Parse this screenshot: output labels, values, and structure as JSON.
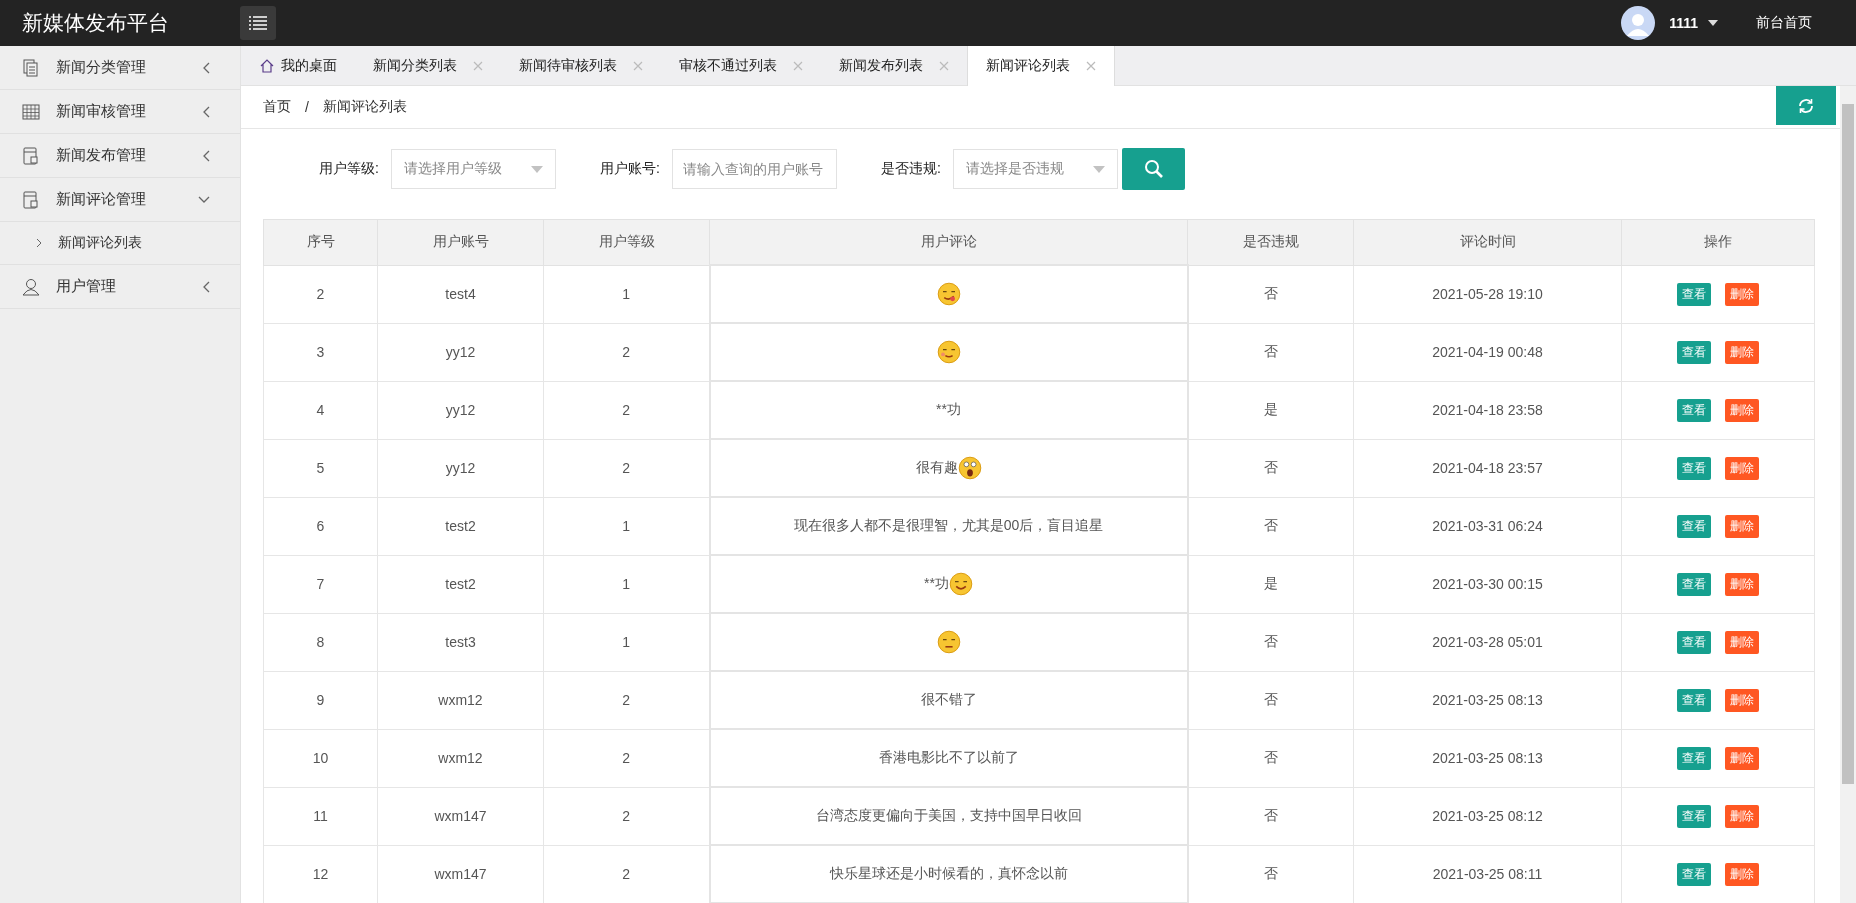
{
  "header": {
    "logo": "新媒体发布平台",
    "user": "1111",
    "home_link": "前台首页"
  },
  "sidebar": {
    "items": [
      {
        "label": "新闻分类管理",
        "expanded": false
      },
      {
        "label": "新闻审核管理",
        "expanded": false
      },
      {
        "label": "新闻发布管理",
        "expanded": false
      },
      {
        "label": "新闻评论管理",
        "expanded": true,
        "children": [
          {
            "label": "新闻评论列表"
          }
        ]
      },
      {
        "label": "用户管理",
        "expanded": false
      }
    ]
  },
  "tabs": [
    {
      "label": "我的桌面",
      "kind": "home",
      "selected": false
    },
    {
      "label": "新闻分类列表",
      "kind": "page",
      "selected": false
    },
    {
      "label": "新闻待审核列表",
      "kind": "page",
      "selected": false
    },
    {
      "label": "审核不通过列表",
      "kind": "page",
      "selected": false
    },
    {
      "label": "新闻发布列表",
      "kind": "page",
      "selected": false
    },
    {
      "label": "新闻评论列表",
      "kind": "page",
      "selected": true
    }
  ],
  "breadcrumb": [
    "首页",
    "/",
    "新闻评论列表"
  ],
  "filters": [
    {
      "label": "用户等级:",
      "kind": "select",
      "placeholder": "请选择用户等级"
    },
    {
      "label": "用户账号:",
      "kind": "input",
      "placeholder": "请输入查询的用户账号"
    },
    {
      "label": "是否违规:",
      "kind": "select",
      "placeholder": "请选择是否违规"
    }
  ],
  "table": {
    "columns": [
      "序号",
      "用户账号",
      "用户等级",
      "用户评论",
      "是否违规",
      "评论时间",
      "操作"
    ],
    "rows": [
      {
        "no": "2",
        "account": "test4",
        "level": "1",
        "kind": "emoji",
        "violation": "否",
        "time": "2021-05-28 19:10",
        "actions": [
          "查看",
          "删除"
        ]
      },
      {
        "no": "3",
        "account": "yy12",
        "level": "2",
        "kind": "emoji",
        "violation": "否",
        "time": "2021-04-19 00:48",
        "actions": [
          "查看",
          "删除"
        ]
      },
      {
        "no": "4",
        "account": "yy12",
        "level": "2",
        "comment": "**功",
        "violation": "是",
        "time": "2021-04-18 23:58",
        "actions": [
          "查看",
          "删除"
        ]
      },
      {
        "no": "5",
        "account": "yy12",
        "level": "2",
        "comment": "很有趣",
        "kind": "text-emoji",
        "violation": "否",
        "time": "2021-04-18 23:57",
        "actions": [
          "查看",
          "删除"
        ]
      },
      {
        "no": "6",
        "account": "test2",
        "level": "1",
        "comment": "现在很多人都不是很理智，尤其是00后，盲目追星",
        "violation": "否",
        "time": "2021-03-31 06:24",
        "actions": [
          "查看",
          "删除"
        ]
      },
      {
        "no": "7",
        "account": "test2",
        "level": "1",
        "comment": "**功",
        "kind": "text-emoji",
        "violation": "是",
        "time": "2021-03-30 00:15",
        "actions": [
          "查看",
          "删除"
        ]
      },
      {
        "no": "8",
        "account": "test3",
        "level": "1",
        "kind": "emoji",
        "violation": "否",
        "time": "2021-03-28 05:01",
        "actions": [
          "查看",
          "删除"
        ]
      },
      {
        "no": "9",
        "account": "wxm12",
        "level": "2",
        "comment": "很不错了",
        "violation": "否",
        "time": "2021-03-25 08:13",
        "actions": [
          "查看",
          "删除"
        ]
      },
      {
        "no": "10",
        "account": "wxm12",
        "level": "2",
        "comment": "香港电影比不了以前了",
        "violation": "否",
        "time": "2021-03-25 08:13",
        "actions": [
          "查看",
          "删除"
        ]
      },
      {
        "no": "11",
        "account": "wxm147",
        "level": "2",
        "comment": "台湾态度更偏向于美国，支持中国早日收回",
        "violation": "否",
        "time": "2021-03-25 08:12",
        "actions": [
          "查看",
          "删除"
        ]
      },
      {
        "no": "12",
        "account": "wxm147",
        "level": "2",
        "comment": "快乐星球还是小时候看的，真怀念以前",
        "violation": "否",
        "time": "2021-03-25 08:11",
        "actions": [
          "查看",
          "删除"
        ]
      }
    ]
  }
}
